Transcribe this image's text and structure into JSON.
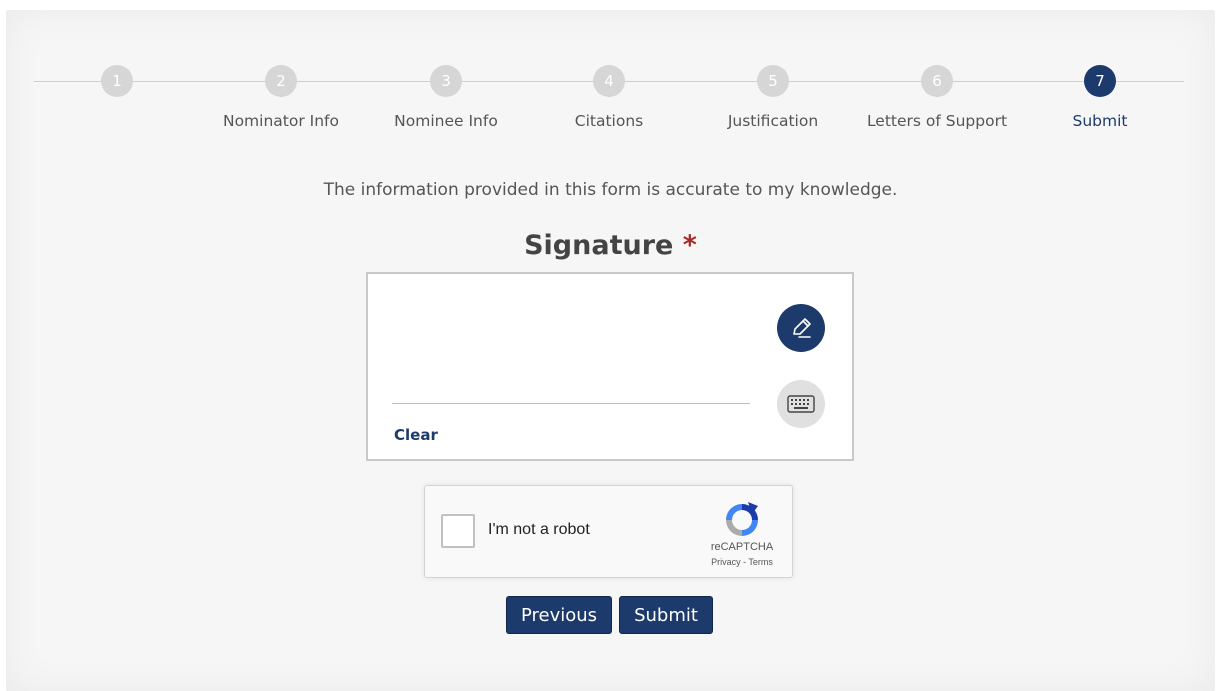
{
  "stepper": {
    "steps": [
      {
        "number": "1",
        "label": ""
      },
      {
        "number": "2",
        "label": "Nominator Info"
      },
      {
        "number": "3",
        "label": "Nominee Info"
      },
      {
        "number": "4",
        "label": "Citations"
      },
      {
        "number": "5",
        "label": "Justification"
      },
      {
        "number": "6",
        "label": "Letters of Support"
      },
      {
        "number": "7",
        "label": "Submit"
      }
    ],
    "active_step": "7"
  },
  "form": {
    "intro": "The information provided in this form is accurate to my knowledge.",
    "signature_title": "Signature",
    "required_mark": "*",
    "clear_label": "Clear",
    "draw_icon": "pen-icon",
    "type_icon": "keyboard-icon"
  },
  "captcha": {
    "label": "I'm not a robot",
    "brand": "reCAPTCHA",
    "links": "Privacy - Terms",
    "checked": false
  },
  "actions": {
    "previous_label": "Previous",
    "submit_label": "Submit"
  },
  "colors": {
    "accent": "#1c3a6b",
    "required": "#a52a2a",
    "inactive_step": "#d6d6d6"
  }
}
